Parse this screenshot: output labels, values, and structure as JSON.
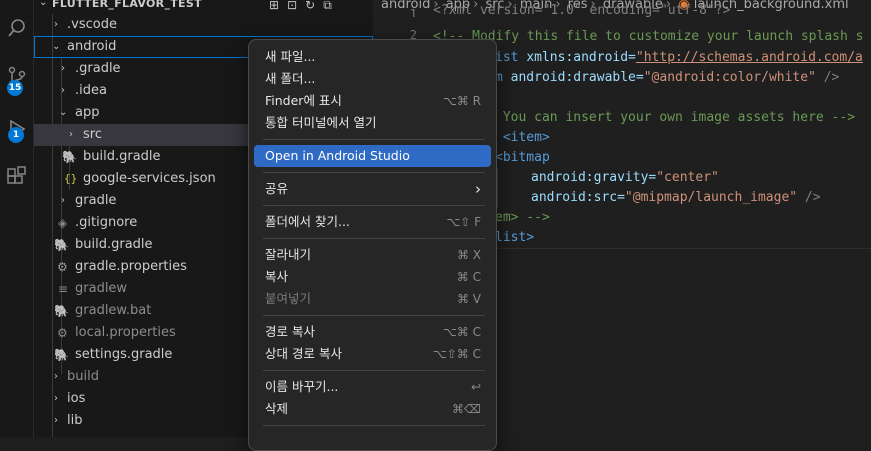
{
  "explorer": {
    "root": "FLUTTER_FLAVOR_TEST",
    "header_icons": [
      "new-file-icon",
      "new-folder-icon",
      "refresh-icon",
      "collapse-all-icon"
    ],
    "tree": [
      {
        "label": ".vscode",
        "kind": "folder",
        "expanded": false
      },
      {
        "label": "android",
        "kind": "folder",
        "expanded": true
      },
      {
        "label": ".gradle",
        "kind": "folder",
        "expanded": false
      },
      {
        "label": ".idea",
        "kind": "folder",
        "expanded": false
      },
      {
        "label": "app",
        "kind": "folder",
        "expanded": true
      },
      {
        "label": "src",
        "kind": "folder",
        "expanded": false
      },
      {
        "label": "build.gradle",
        "kind": "gradle-file"
      },
      {
        "label": "google-services.json",
        "kind": "json-file"
      },
      {
        "label": "gradle",
        "kind": "folder",
        "expanded": false
      },
      {
        "label": ".gitignore",
        "kind": "gitignore-file"
      },
      {
        "label": "build.gradle",
        "kind": "gradle-file"
      },
      {
        "label": "gradle.properties",
        "kind": "settings-file"
      },
      {
        "label": "gradlew",
        "kind": "text-file"
      },
      {
        "label": "gradlew.bat",
        "kind": "gradle-file"
      },
      {
        "label": "local.properties",
        "kind": "settings-file"
      },
      {
        "label": "settings.gradle",
        "kind": "gradle-file"
      },
      {
        "label": "build",
        "kind": "folder",
        "expanded": false
      },
      {
        "label": "ios",
        "kind": "folder",
        "expanded": false
      },
      {
        "label": "lib",
        "kind": "folder",
        "expanded": false
      }
    ]
  },
  "activity": {
    "source_control_badge": "15",
    "run_badge": "1"
  },
  "breadcrumbs": [
    "android",
    "app",
    "src",
    "main",
    "res",
    "drawable",
    "launch_background.xml"
  ],
  "code": {
    "line1_partial": "<?xml version=\"1.0\" encoding=\"utf-8\"?>",
    "line2": "<!-- Modify this file to customize your launch splash s",
    "line3a": "ist ",
    "line3_attr": "xmlns:android=",
    "line3_val": "\"http://schemas.android.com/a",
    "line4a": "m ",
    "line4_attr": "android:drawable=",
    "line4_val": "\"@android:color/white\"",
    "line4_end": " />",
    "line6": " You can insert your own image assets here -->",
    "line7": " <item>",
    "line8": "<bitmap",
    "line9_attr": "android:gravity=",
    "line9_val": "\"center\"",
    "line10_attr": "android:src=",
    "line10_val": "\"@mipmap/launch_image\"",
    "line10_end": " />",
    "line11": "em> -->",
    "line12": "list>",
    "line_numbers": [
      "1",
      "2"
    ]
  },
  "menu": {
    "items": [
      {
        "label": "새 파일...",
        "shortcut": ""
      },
      {
        "label": "새 폴더...",
        "shortcut": ""
      },
      {
        "label": "Finder에 표시",
        "shortcut": "⌥⌘ R"
      },
      {
        "label": "통합 터미널에서 열기",
        "shortcut": ""
      },
      {
        "label": "Open in Android Studio",
        "shortcut": ""
      },
      {
        "label": "공유",
        "shortcut": "›"
      },
      {
        "label": "폴더에서 찾기...",
        "shortcut": "⌥⇧ F"
      },
      {
        "label": "잘라내기",
        "shortcut": "⌘ X"
      },
      {
        "label": "복사",
        "shortcut": "⌘ C"
      },
      {
        "label": "붙여넣기",
        "shortcut": "⌘ V"
      },
      {
        "label": "경로 복사",
        "shortcut": "⌥⌘ C"
      },
      {
        "label": "상대 경로 복사",
        "shortcut": "⌥⇧⌘ C"
      },
      {
        "label": "이름 바꾸기...",
        "shortcut": "↩"
      },
      {
        "label": "삭제",
        "shortcut": "⌘⌫"
      }
    ]
  },
  "colors": {
    "accent": "#0078d4",
    "menu_highlight": "#2f6bc5",
    "folder_android_icon": "#a4c639",
    "gradle_icon": "#4a90a4",
    "json_icon": "#cbcb41"
  }
}
